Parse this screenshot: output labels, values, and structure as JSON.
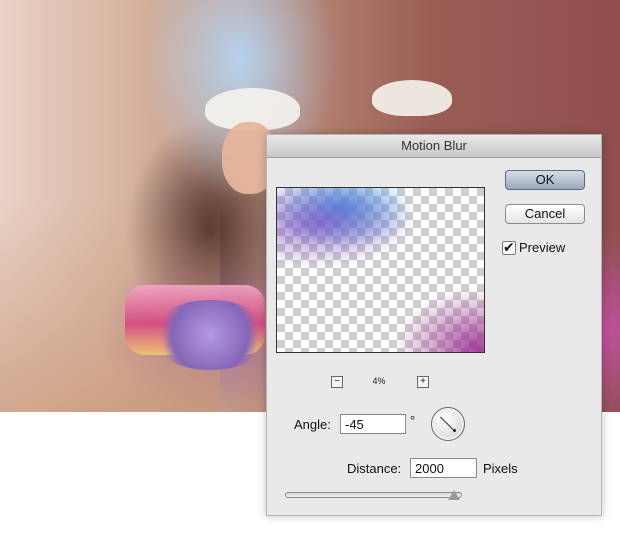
{
  "dialog": {
    "title": "Motion Blur",
    "ok_label": "OK",
    "cancel_label": "Cancel",
    "preview": {
      "label": "Preview",
      "checked": true,
      "check_glyph": "✔"
    },
    "zoom": {
      "minus": "−",
      "plus": "+",
      "value": "4%"
    },
    "angle": {
      "label": "Angle:",
      "value": "-45",
      "unit": "°"
    },
    "distance": {
      "label": "Distance:",
      "value": "2000",
      "unit": "Pixels",
      "slider_fraction": 1.0
    }
  },
  "icons": {
    "angle_dial": "angle-dial-icon"
  },
  "colors": {
    "ok_button": "#9aa7bb",
    "dialog_bg": "#e9e9e9"
  }
}
